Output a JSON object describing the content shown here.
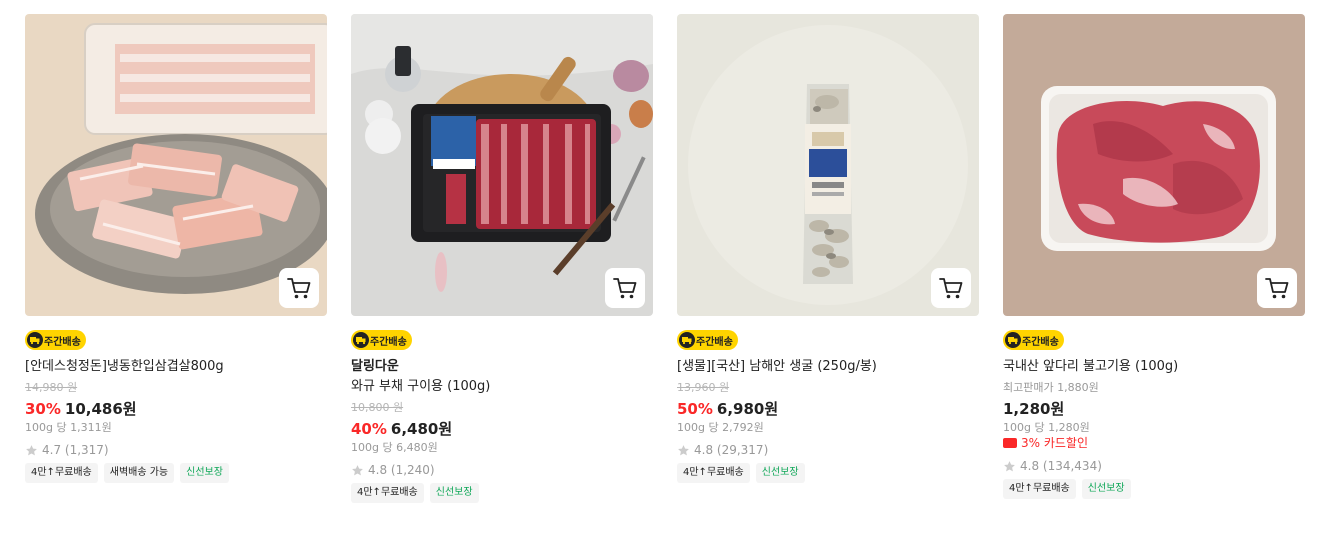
{
  "products": [
    {
      "image_alt": "냉동 한입 삼겹살",
      "badge": "주간배송",
      "brand": "",
      "name": "[안데스청정돈]냉동한입삼겹살800g",
      "original_price": "14,980 원",
      "max_price": "",
      "discount": "30%",
      "price": "10,486원",
      "unit_price": "100g 당 1,311원",
      "card_discount": "",
      "rating": "4.7 (1,317)",
      "tags": [
        {
          "label": "4만↑무료배송",
          "style": "default"
        },
        {
          "label": "새벽배송 가능",
          "style": "default"
        },
        {
          "label": "신선보장",
          "style": "green"
        }
      ]
    },
    {
      "image_alt": "와규 부채 구이용",
      "badge": "주간배송",
      "brand": "달링다운",
      "name": "와규 부채 구이용 (100g)",
      "original_price": "10,800 원",
      "max_price": "",
      "discount": "40%",
      "price": "6,480원",
      "unit_price": "100g 당 6,480원",
      "card_discount": "",
      "rating": "4.8 (1,240)",
      "tags": [
        {
          "label": "4만↑무료배송",
          "style": "default"
        },
        {
          "label": "신선보장",
          "style": "green"
        }
      ]
    },
    {
      "image_alt": "남해안 생굴",
      "badge": "주간배송",
      "brand": "",
      "name": "[생물][국산] 남해안 생굴 (250g/봉)",
      "original_price": "13,960 원",
      "max_price": "",
      "discount": "50%",
      "price": "6,980원",
      "unit_price": "100g 당 2,792원",
      "card_discount": "",
      "rating": "4.8 (29,317)",
      "tags": [
        {
          "label": "4만↑무료배송",
          "style": "default"
        },
        {
          "label": "신선보장",
          "style": "green"
        }
      ]
    },
    {
      "image_alt": "국내산 앞다리 불고기용",
      "badge": "주간배송",
      "brand": "",
      "name": "국내산 앞다리 불고기용 (100g)",
      "original_price": "",
      "max_price": "최고판매가 1,880원",
      "discount": "",
      "price": "1,280원",
      "unit_price": "100g 당 1,280원",
      "card_discount": "3% 카드할인",
      "rating": "4.8 (134,434)",
      "tags": [
        {
          "label": "4만↑무료배송",
          "style": "default"
        },
        {
          "label": "신선보장",
          "style": "green"
        }
      ]
    }
  ],
  "icons": {
    "cart": "cart-icon",
    "truck": "truck-icon",
    "star": "star-icon",
    "card": "credit-card-icon"
  },
  "colors": {
    "discount": "#fa2828",
    "badge_bg": "#ffd400",
    "fresh_tag": "#0fa758",
    "rating_star": "#cccccc"
  }
}
